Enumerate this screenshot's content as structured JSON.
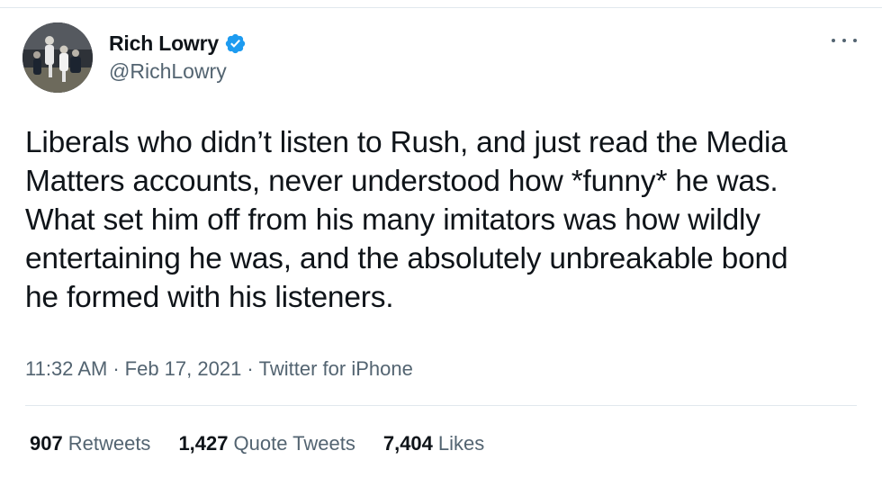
{
  "author": {
    "display_name": "Rich Lowry",
    "handle": "@RichLowry",
    "verified": true,
    "avatar_icon": "avatar-photo"
  },
  "tweet": {
    "text": "Liberals who didn’t listen to Rush, and just read the Media\nMatters accounts, never understood how *funny* he was.\nWhat set him off from his many imitators was how wildly\nentertaining he was, and the absolutely unbreakable bond\nhe formed with his listeners.",
    "time": "11:32 AM",
    "date": "Feb 17, 2021",
    "source": "Twitter for iPhone",
    "separator": "·"
  },
  "stats": {
    "retweets_count": "907",
    "retweets_label": "Retweets",
    "quotes_count": "1,427",
    "quotes_label": "Quote Tweets",
    "likes_count": "7,404",
    "likes_label": "Likes"
  },
  "colors": {
    "text_primary": "#0f1419",
    "text_secondary": "#536471",
    "verified_blue": "#1d9bf0",
    "divider": "#e1e8ed"
  }
}
